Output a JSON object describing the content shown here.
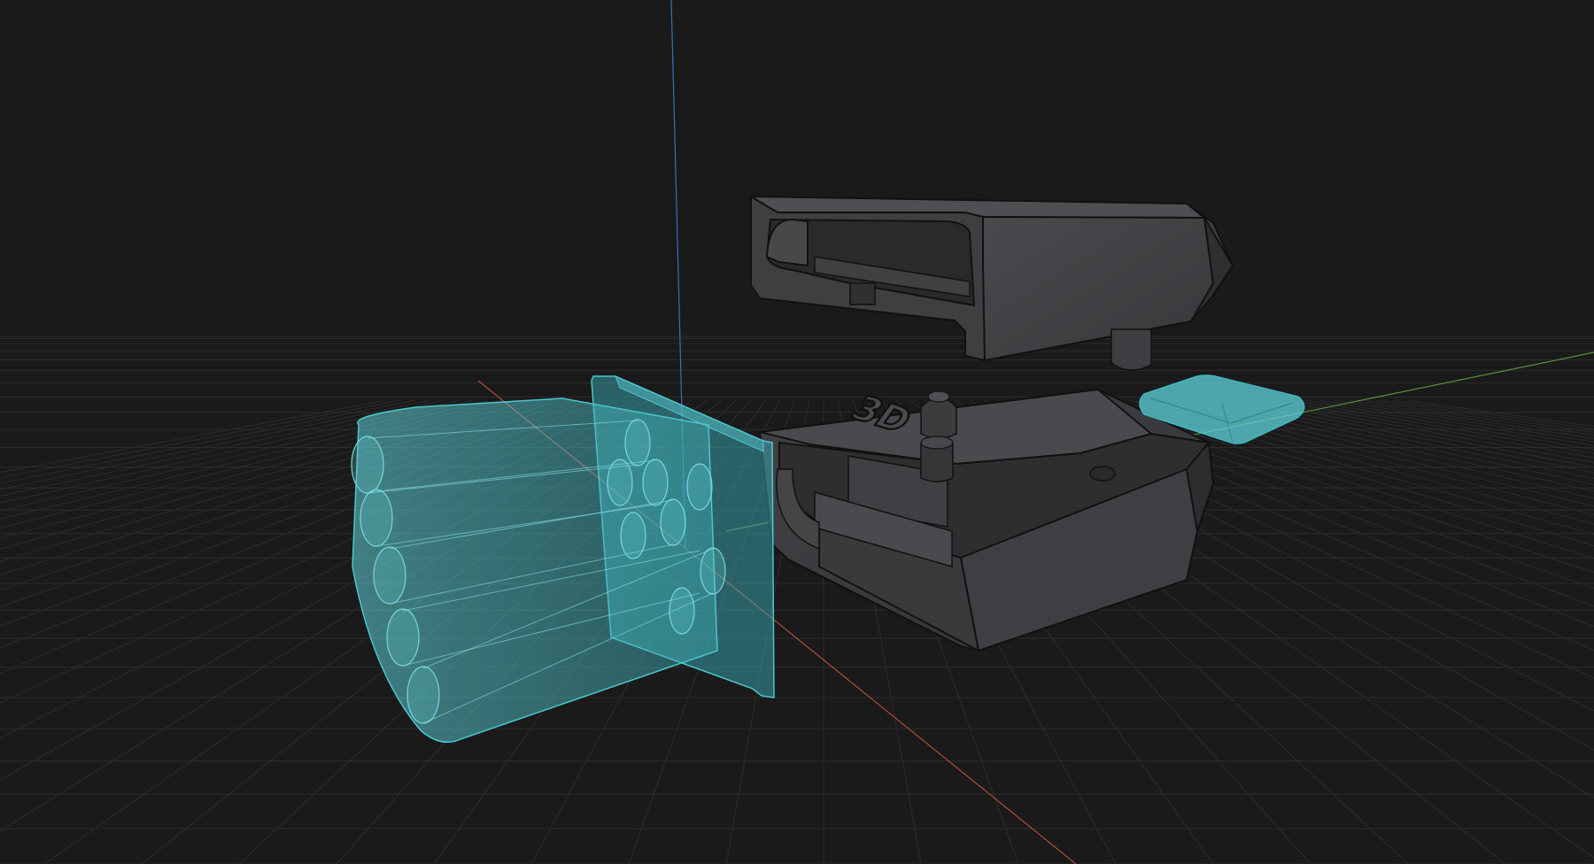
{
  "viewport": {
    "background_color": "#1a1a1a",
    "grid_color": "#2c2c2c",
    "axis_colors": {
      "x": "#b34a3a",
      "y": "#5b8f3d",
      "z": "#3b6fb5"
    }
  },
  "objects": {
    "battery_holder": {
      "icon": "battery-pack-icon",
      "color": "#5fd3dc",
      "selected": true
    },
    "lid": {
      "icon": "lid-icon",
      "color": "#3f3f42"
    },
    "base": {
      "icon": "base-housing-icon",
      "color": "#3b3b3e",
      "embossed_text": "3D"
    },
    "usb_connector": {
      "icon": "usb-c-connector-icon",
      "color": "#5fd3dc",
      "selected": true
    }
  }
}
